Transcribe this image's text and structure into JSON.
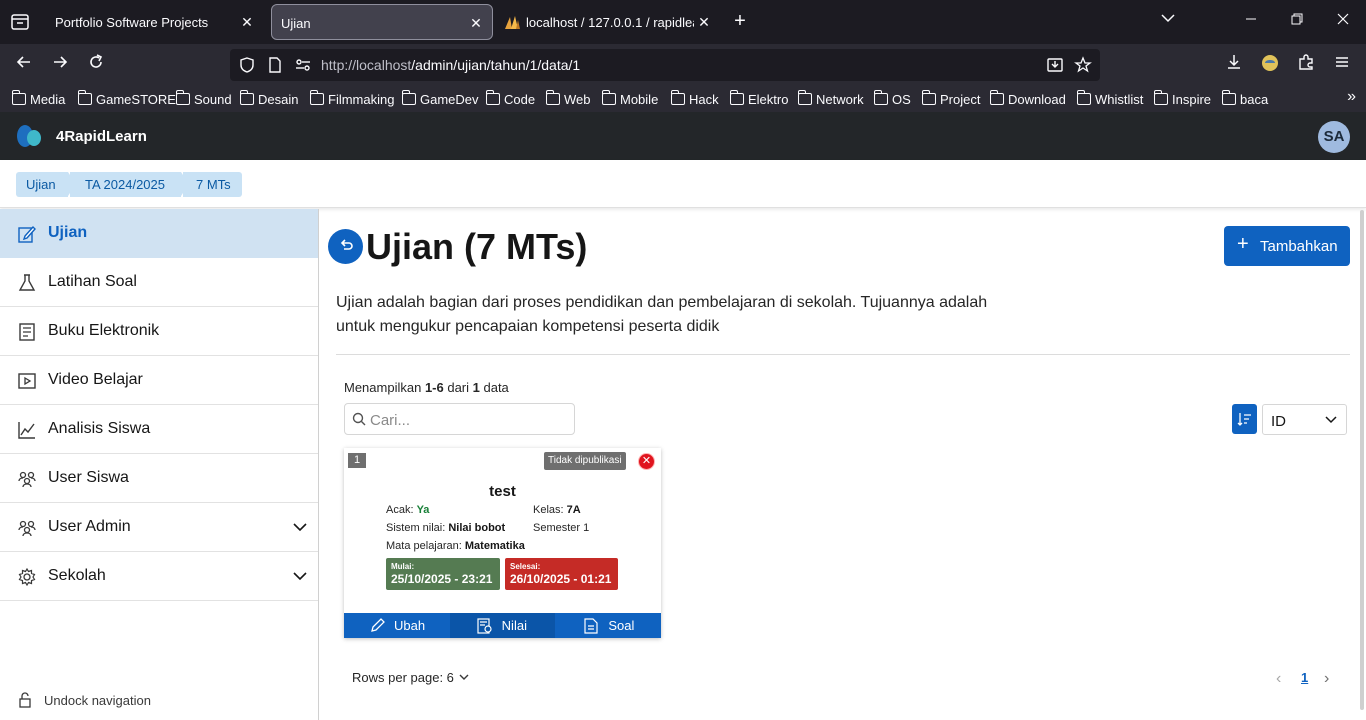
{
  "browser": {
    "tabs": [
      {
        "title": "Portfolio Software Projects"
      },
      {
        "title": "Ujian"
      },
      {
        "title": "localhost / 127.0.0.1 / rapidlearn"
      }
    ],
    "url_host": "http://localhost",
    "url_path": "/admin/ujian/tahun/1/data/1",
    "bookmarks": [
      "Media",
      "GameSTORE",
      "Sound",
      "Desain",
      "Filmmaking",
      "GameDev",
      "Code",
      "Web",
      "Mobile",
      "Hack",
      "Elektro",
      "Network",
      "OS",
      "Project",
      "Download",
      "Whistlist",
      "Inspire",
      "baca"
    ]
  },
  "app": {
    "brand": "4RapidLearn",
    "avatar_initials": "SA"
  },
  "breadcrumb": [
    "Ujian",
    "TA 2024/2025",
    "7 MTs"
  ],
  "sidebar": {
    "items": [
      {
        "label": "Ujian",
        "icon": "edit-icon",
        "active": true
      },
      {
        "label": "Latihan Soal",
        "icon": "flask-icon"
      },
      {
        "label": "Buku Elektronik",
        "icon": "book-icon"
      },
      {
        "label": "Video Belajar",
        "icon": "video-icon"
      },
      {
        "label": "Analisis Siswa",
        "icon": "chart-line-icon"
      },
      {
        "label": "User Siswa",
        "icon": "users-icon"
      },
      {
        "label": "User Admin",
        "icon": "users-admin-icon",
        "expandable": true
      },
      {
        "label": "Sekolah",
        "icon": "gear-icon",
        "expandable": true
      }
    ],
    "undock_label": "Undock navigation"
  },
  "main": {
    "title": "Ujian (7 MTs)",
    "add_button": "Tambahkan",
    "description": "Ujian adalah bagian dari proses pendidikan dan pembelajaran di sekolah. Tujuannya adalah untuk mengukur pencapaian kompetensi peserta didik",
    "showing_prefix": "Menampilkan ",
    "showing_range": "1-6",
    "showing_mid": " dari ",
    "showing_total": "1",
    "showing_suffix": " data",
    "search_placeholder": "Cari...",
    "sort_value": "ID"
  },
  "card": {
    "number": "1",
    "badge": "Tidak dipublikasi",
    "title": "test",
    "acak_label": "Acak: ",
    "acak_value": "Ya",
    "kelas_label": "Kelas: ",
    "kelas_value": "7A",
    "sistem_label": "Sistem nilai: ",
    "sistem_value": "Nilai bobot",
    "semester": "Semester 1",
    "mapel_label": "Mata pelajaran: ",
    "mapel_value": "Matematika",
    "start_label": "Mulai:",
    "start_value": "25/10/2025 - 23:21",
    "end_label": "Selesai:",
    "end_value": "26/10/2025 - 01:21",
    "actions": [
      "Ubah",
      "Nilai",
      "Soal"
    ]
  },
  "pagination": {
    "rows_label": "Rows per page: 6",
    "current_page": "1"
  },
  "colors": {
    "primary": "#0f62c0",
    "active_bg": "#d0e2f2",
    "start_green": "#557b52",
    "end_red": "#c52b26"
  }
}
